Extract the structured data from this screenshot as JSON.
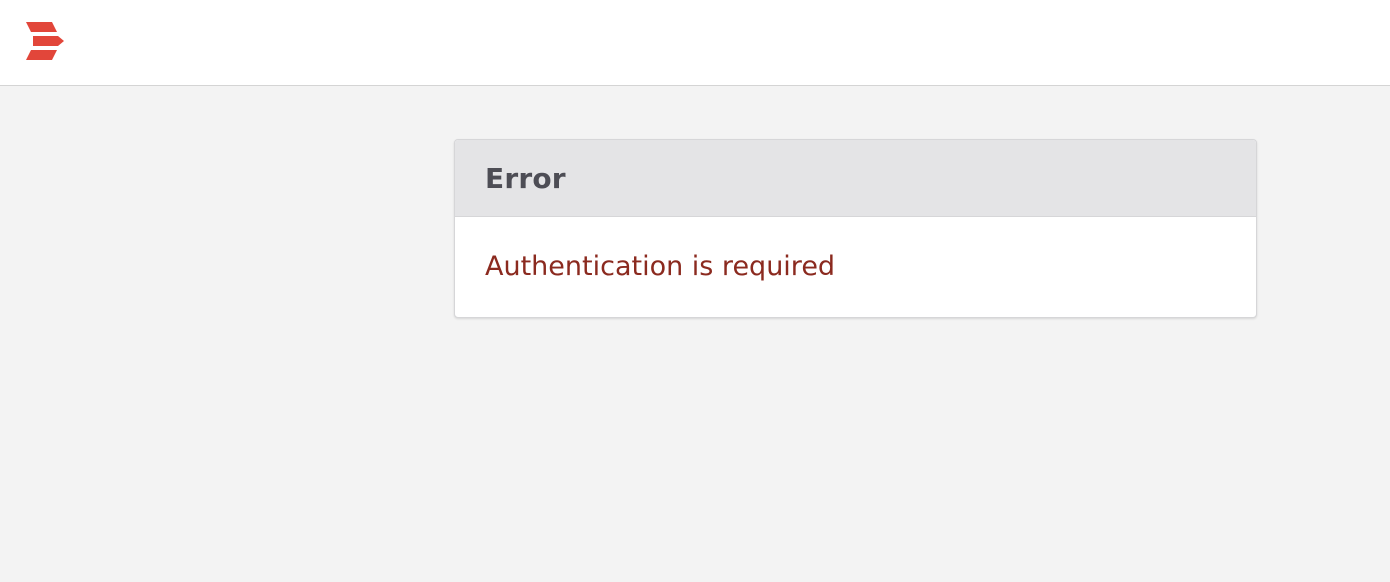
{
  "header": {
    "logo_icon": "brand-logo-icon",
    "brand_color": "#e2463a"
  },
  "error_card": {
    "title": "Error",
    "message": "Authentication is required",
    "message_color": "#8b2a1f"
  }
}
